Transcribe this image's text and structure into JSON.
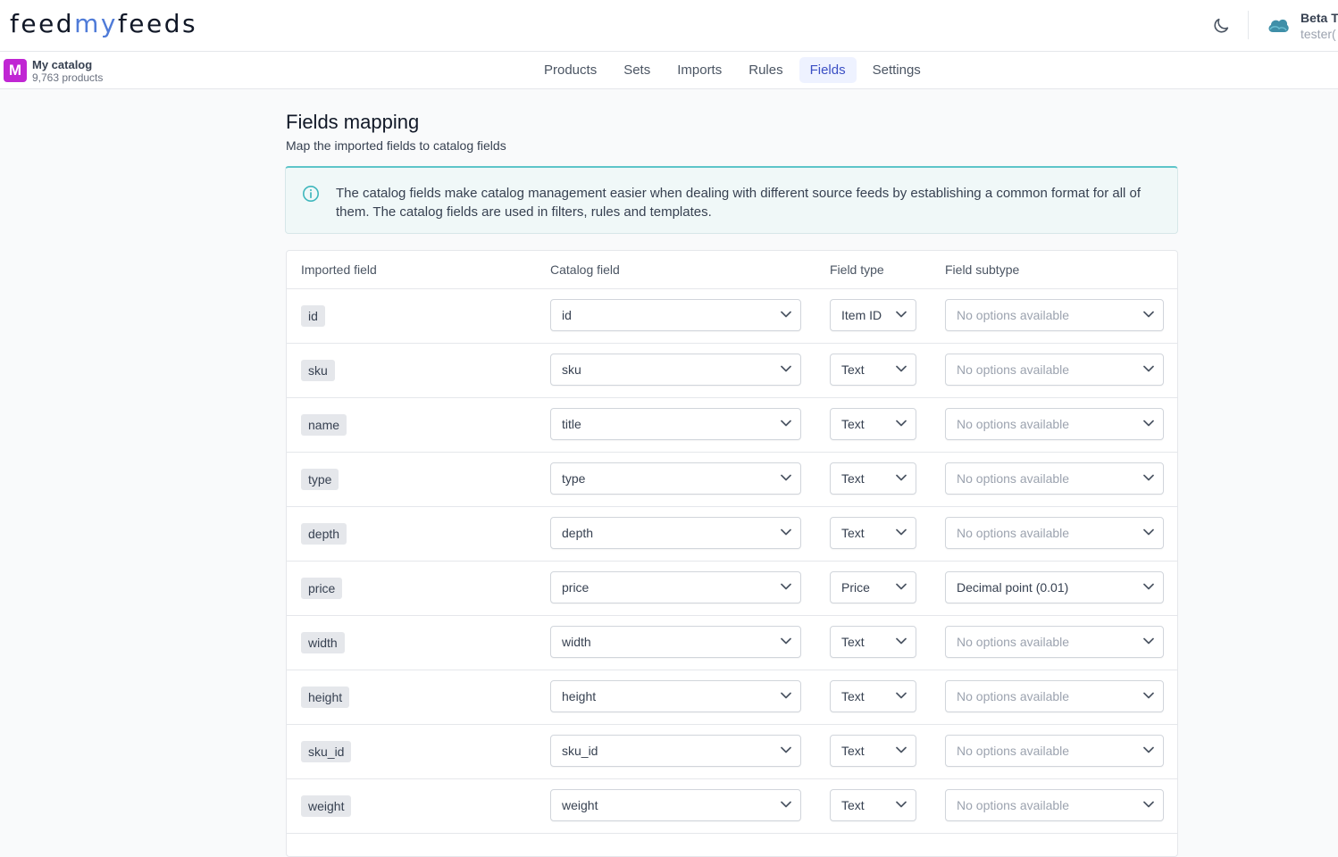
{
  "header": {
    "logo": {
      "part1": "feed",
      "part2": "my",
      "part3": "feeds"
    },
    "theme_icon": "moon-icon",
    "user_icon": "cloud-icon",
    "user_name": "Beta T",
    "user_email": "tester("
  },
  "catalog": {
    "avatar_letter": "M",
    "name": "My catalog",
    "count": "9,763 products"
  },
  "tabs": [
    {
      "label": "Products"
    },
    {
      "label": "Sets"
    },
    {
      "label": "Imports"
    },
    {
      "label": "Rules"
    },
    {
      "label": "Fields",
      "active": true
    },
    {
      "label": "Settings"
    }
  ],
  "page": {
    "title": "Fields mapping",
    "subtitle": "Map the imported fields to catalog fields"
  },
  "info": {
    "icon": "info-icon",
    "text": "The catalog fields make catalog management easier when dealing with different source feeds by establishing a common format for all of them. The catalog fields are used in filters, rules and templates."
  },
  "table": {
    "headers": {
      "imported": "Imported field",
      "catalog": "Catalog field",
      "type": "Field type",
      "subtype": "Field subtype"
    },
    "rows": [
      {
        "imported": "id",
        "catalog": "id",
        "type": "Item ID",
        "subtype": "No options available",
        "subtype_placeholder": true
      },
      {
        "imported": "sku",
        "catalog": "sku",
        "type": "Text",
        "subtype": "No options available",
        "subtype_placeholder": true
      },
      {
        "imported": "name",
        "catalog": "title",
        "type": "Text",
        "subtype": "No options available",
        "subtype_placeholder": true
      },
      {
        "imported": "type",
        "catalog": "type",
        "type": "Text",
        "subtype": "No options available",
        "subtype_placeholder": true
      },
      {
        "imported": "depth",
        "catalog": "depth",
        "type": "Text",
        "subtype": "No options available",
        "subtype_placeholder": true
      },
      {
        "imported": "price",
        "catalog": "price",
        "type": "Price",
        "subtype": "Decimal point (0.01)",
        "subtype_placeholder": false
      },
      {
        "imported": "width",
        "catalog": "width",
        "type": "Text",
        "subtype": "No options available",
        "subtype_placeholder": true
      },
      {
        "imported": "height",
        "catalog": "height",
        "type": "Text",
        "subtype": "No options available",
        "subtype_placeholder": true
      },
      {
        "imported": "sku_id",
        "catalog": "sku_id",
        "type": "Text",
        "subtype": "No options available",
        "subtype_placeholder": true
      },
      {
        "imported": "weight",
        "catalog": "weight",
        "type": "Text",
        "subtype": "No options available",
        "subtype_placeholder": true
      }
    ]
  },
  "colors": {
    "accent": "#3b4fc4",
    "logo_accent": "#4f7bd8",
    "avatar": "#c026d3",
    "info_border": "#5ec5c9"
  }
}
